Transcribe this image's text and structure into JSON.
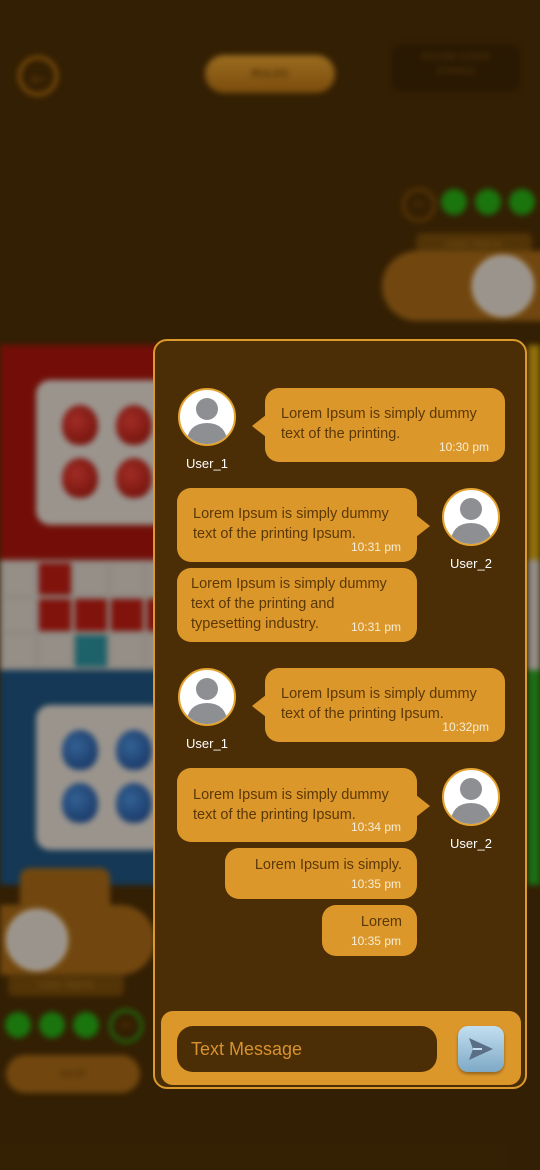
{
  "background": {
    "rules_label": "RULES",
    "room_code_label": "ROOM CODE",
    "room_code_value": "8760932",
    "top_player_name": "User Name",
    "bottom_player_name": "User Name",
    "top_timer": "0%",
    "bottom_timer": "0%",
    "skip_label": "SKIP"
  },
  "chat": {
    "messages": [
      {
        "user": "User_1",
        "side": "left",
        "text": "Lorem Ipsum is simply dummy text of the printing.",
        "time": "10:30 pm"
      },
      {
        "user": "User_2",
        "side": "right",
        "text": "Lorem Ipsum is simply dummy text of the printing Ipsum.",
        "time": "10:31 pm"
      },
      {
        "user": "User_2",
        "side": "right",
        "text": "Lorem Ipsum is simply dummy text of the printing and typesetting industry.",
        "time": "10:31 pm"
      },
      {
        "user": "User_1",
        "side": "left",
        "text": "Lorem Ipsum is simply dummy text of the printing Ipsum.",
        "time": "10:32pm"
      },
      {
        "user": "User_2",
        "side": "right",
        "text": "Lorem Ipsum is simply dummy text of the printing Ipsum.",
        "time": "10:34 pm"
      },
      {
        "user": "User_2",
        "side": "right",
        "text": "Lorem Ipsum is simply.",
        "time": "10:35 pm"
      },
      {
        "user": "User_2",
        "side": "right",
        "text": "Lorem",
        "time": "10:35 pm"
      }
    ],
    "input_placeholder": "Text Message",
    "send_icon": "send-icon"
  },
  "colors": {
    "panel_bg": "#4b2e06",
    "bubble": "#dc972b",
    "accent_border": "#e3a32e"
  }
}
